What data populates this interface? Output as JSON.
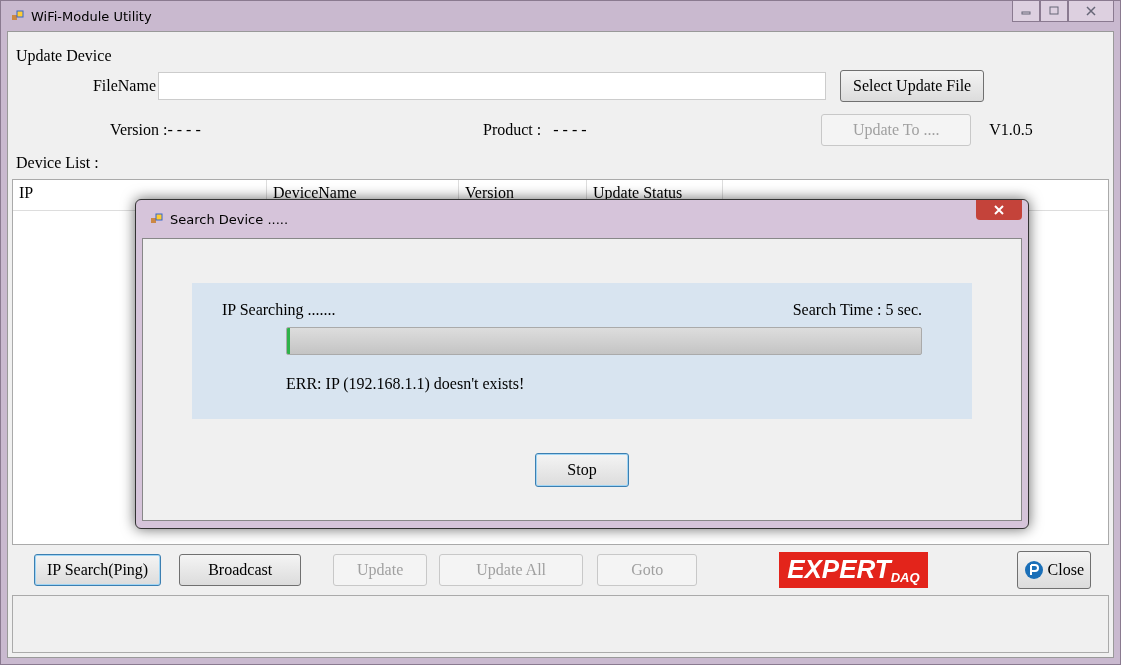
{
  "window": {
    "title": "WiFi-Module Utility"
  },
  "update_device": {
    "legend": "Update Device",
    "filename_label": "FileName",
    "select_button": {
      "label": "Select Update File",
      "disabled": false
    },
    "version_label": "Version",
    "version_value": ":- - - -",
    "product_label": "Product :",
    "product_value": "- - - -",
    "update_to_button": {
      "label": "Update To ....",
      "disabled": true
    },
    "app_version": "V1.0.5"
  },
  "device_list": {
    "label": "Device List :",
    "columns": [
      "IP",
      "DeviceName",
      "Version",
      "Update Status"
    ]
  },
  "buttons": [
    {
      "label": "IP Search(Ping)",
      "disabled": false,
      "focused": true
    },
    {
      "label": "Broadcast",
      "disabled": false,
      "focused": false
    },
    {
      "label": "Update",
      "disabled": true,
      "focused": false
    },
    {
      "label": "Update All",
      "disabled": true,
      "focused": false
    },
    {
      "label": "Goto",
      "disabled": true,
      "focused": false
    }
  ],
  "logo": "EXPERT$_{DAQ}$",
  "close_button": {
    "label": "Close"
  },
  "dialog": {
    "title": "Search Device .....",
    "status": "IP Searching .......",
    "search_time": "Search Time : 5 sec.",
    "progress": {
      "level": 0.005
    },
    "message": "ERR: IP (192.168.1.1) doesn't exists!",
    "stop_button": {
      "label": "Stop",
      "focused": true
    }
  }
}
